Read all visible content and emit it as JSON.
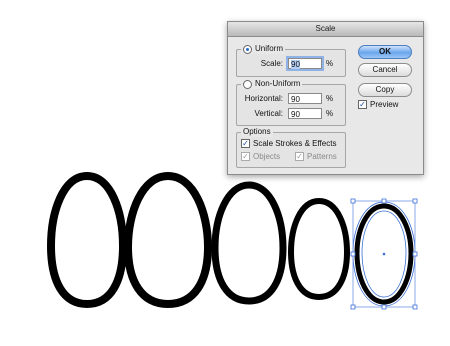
{
  "dialog": {
    "title": "Scale",
    "uniform": {
      "label": "Uniform",
      "selected": true,
      "scale_label": "Scale:",
      "scale_value": "90",
      "unit": "%"
    },
    "non_uniform": {
      "label": "Non-Uniform",
      "selected": false,
      "horizontal_label": "Horizontal:",
      "horizontal_value": "90",
      "vertical_label": "Vertical:",
      "vertical_value": "90",
      "unit": "%"
    },
    "options": {
      "label": "Options",
      "scale_strokes_label": "Scale Strokes & Effects",
      "scale_strokes_checked": true,
      "objects_label": "Objects",
      "objects_checked": true,
      "patterns_label": "Patterns",
      "patterns_checked": true
    },
    "buttons": {
      "ok": "OK",
      "cancel": "Cancel",
      "copy": "Copy"
    },
    "preview": {
      "label": "Preview",
      "checked": true
    }
  },
  "artboard": {
    "shapes": [
      {
        "name": "egg-shape-1",
        "stroke_weight": "heavy",
        "selected": false
      },
      {
        "name": "egg-shape-2",
        "stroke_weight": "heavy",
        "selected": false
      },
      {
        "name": "egg-shape-3",
        "stroke_weight": "heavy",
        "selected": false
      },
      {
        "name": "egg-shape-4",
        "stroke_weight": "heavy",
        "selected": false
      },
      {
        "name": "egg-shape-5",
        "stroke_weight": "heavy",
        "selected": true
      }
    ],
    "selection_color": "#3b6fd8",
    "stroke_color": "#000000",
    "fill_color": "#ffffff"
  }
}
